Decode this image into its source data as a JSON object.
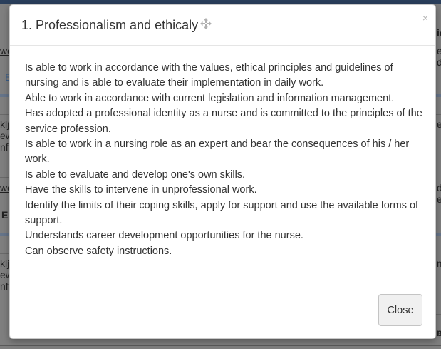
{
  "background": {
    "fragments": [
      "wet",
      "E",
      "klj",
      "ew",
      "nfo",
      "wet",
      "Ex",
      "klj",
      "ew",
      "nfo",
      "ic",
      "e",
      "d",
      "e",
      "d",
      "e",
      "m",
      "m",
      "e"
    ]
  },
  "modal": {
    "title": "1. Professionalism and ethicaly",
    "close_symbol": "×",
    "body_lines": [
      "Is able to work in accordance with the values, ethical principles and guidelines of nursing and is able to evaluate their implementation in daily work.",
      "Able to work in accordance with current legislation and information management.",
      "Has adopted a professional identity as a nurse and is committed to the principles of the service profession.",
      "Is able to work in a nursing role as an expert and bear the consequences of his / her work.",
      "Is able to evaluate and develop one's own skills.",
      "Have the skills to intervene in unprofessional work.",
      "Identify the limits of their coping skills, apply for support and use the available forms of support.",
      "Understands career development opportunities for the nurse.",
      "Can observe safety instructions."
    ],
    "footer_button": "Close"
  },
  "icons": {
    "move": "move-icon",
    "close": "close-icon"
  }
}
